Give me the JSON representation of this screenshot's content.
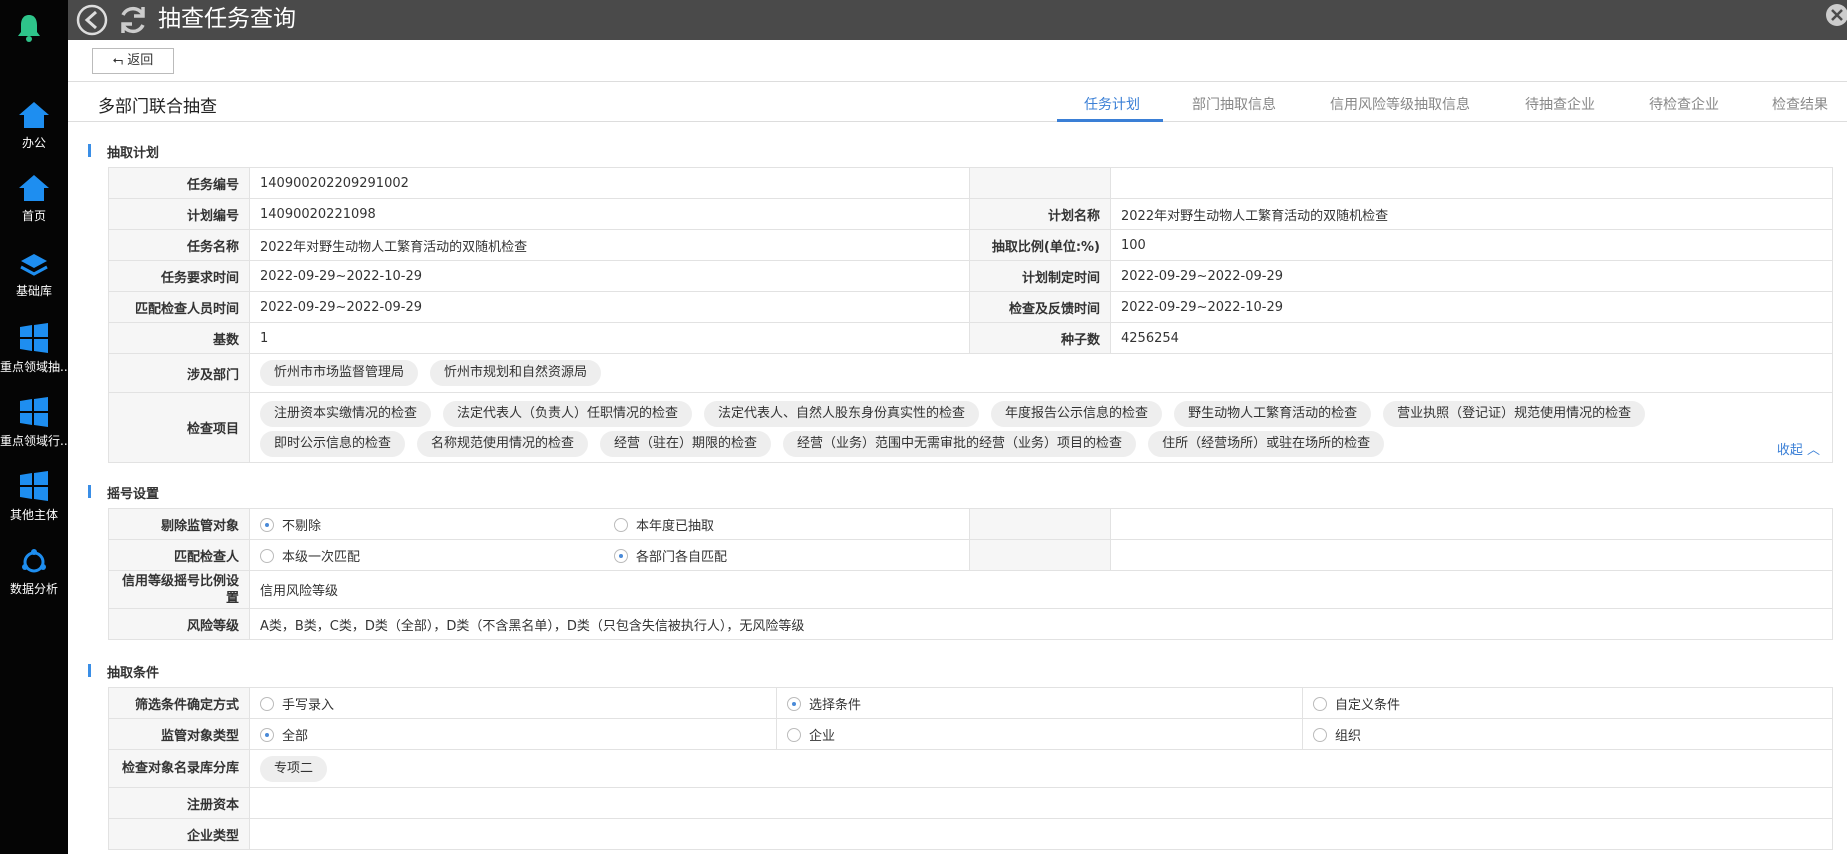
{
  "window": {
    "title": "抽查任务查询",
    "back_label": "返回"
  },
  "sidebar": {
    "items": [
      {
        "label": "办公",
        "icon": "home-icon"
      },
      {
        "label": "首页",
        "icon": "home-icon"
      },
      {
        "label": "基础库",
        "icon": "layers-icon"
      },
      {
        "label": "重点领域抽...",
        "icon": "windows-icon"
      },
      {
        "label": "重点领域行...",
        "icon": "windows-icon"
      },
      {
        "label": "其他主体",
        "icon": "windows-icon"
      },
      {
        "label": "数据分析",
        "icon": "cycle-icon"
      }
    ]
  },
  "header": {
    "title": "多部门联合抽查",
    "tabs": [
      "任务计划",
      "部门抽取信息",
      "信用风险等级抽取信息",
      "待抽查企业",
      "待检查企业",
      "检查结果"
    ],
    "active_tab": "任务计划"
  },
  "plan": {
    "section_title": "抽取计划",
    "rows": [
      {
        "k1": "任务编号",
        "v1": "140900202209291002",
        "k2": "",
        "v2": ""
      },
      {
        "k1": "计划编号",
        "v1": "14090020221098",
        "k2": "计划名称",
        "v2": "2022年对野生动物人工繁育活动的双随机检查"
      },
      {
        "k1": "任务名称",
        "v1": "2022年对野生动物人工繁育活动的双随机检查",
        "k2": "抽取比例(单位:%)",
        "v2": "100"
      },
      {
        "k1": "任务要求时间",
        "v1": "2022-09-29~2022-10-29",
        "k2": "计划制定时间",
        "v2": "2022-09-29~2022-09-29"
      },
      {
        "k1": "匹配检查人员时间",
        "v1": "2022-09-29~2022-09-29",
        "k2": "检查及反馈时间",
        "v2": "2022-09-29~2022-10-29"
      },
      {
        "k1": "基数",
        "v1": "1",
        "k2": "种子数",
        "v2": "4256254"
      }
    ],
    "departments_label": "涉及部门",
    "departments": [
      "忻州市市场监督管理局",
      "忻州市规划和自然资源局"
    ],
    "items_label": "检查项目",
    "items": [
      "注册资本实缴情况的检查",
      "法定代表人（负责人）任职情况的检查",
      "法定代表人、自然人股东身份真实性的检查",
      "年度报告公示信息的检查",
      "野生动物人工繁育活动的检查",
      "营业执照（登记证）规范使用情况的检查",
      "即时公示信息的检查",
      "名称规范使用情况的检查",
      "经营（驻在）期限的检查",
      "经营（业务）范围中无需审批的经营（业务）项目的检查",
      "住所（经营场所）或驻在场所的检查"
    ],
    "collapse_label": "收起"
  },
  "lottery": {
    "section_title": "摇号设置",
    "exclude_label": "剔除监管对象",
    "exclude_opt1": "不剔除",
    "exclude_opt2": "本年度已抽取",
    "match_label": "匹配检查人",
    "match_opt1": "本级一次匹配",
    "match_opt2": "各部门各自匹配",
    "credit_label": "信用等级摇号比例设置",
    "credit_value": "信用风险等级",
    "risk_label": "风险等级",
    "risk_value": "A类，B类，C类，D类（全部），D类（不含黑名单），D类（只包含失信被执行人），无风险等级"
  },
  "conditions": {
    "section_title": "抽取条件",
    "filter_label": "筛选条件确定方式",
    "filter_opts": [
      "手写录入",
      "选择条件",
      "自定义条件"
    ],
    "type_label": "监管对象类型",
    "type_opts": [
      "全部",
      "企业",
      "组织"
    ],
    "library_label": "检查对象名录库分库",
    "library_tag": "专项二",
    "capital_label": "注册资本",
    "etype_label": "企业类型"
  }
}
